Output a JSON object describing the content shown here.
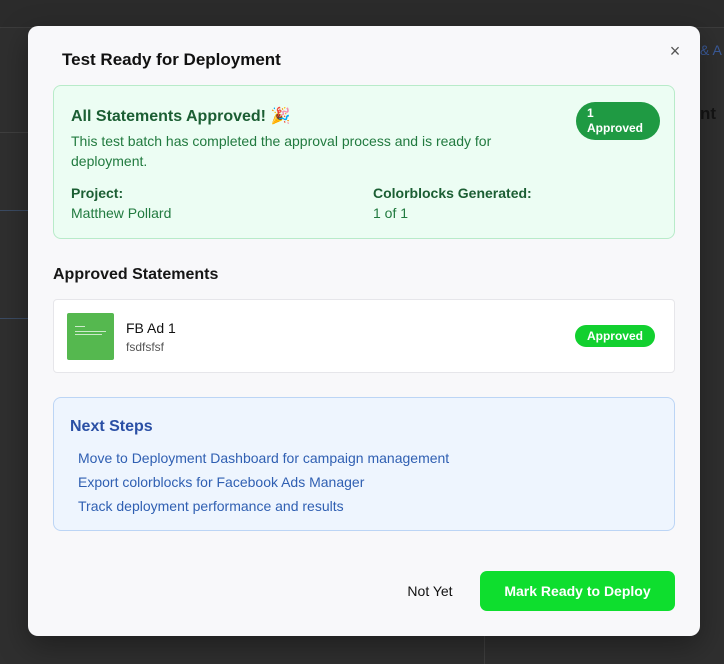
{
  "background": {
    "tabs_fragment": "& A",
    "title_fragment": "nt"
  },
  "modal": {
    "title": "Test Ready for Deployment",
    "close_icon": "×",
    "status_card": {
      "heading": "All Statements Approved! 🎉",
      "description": "This test batch has completed the approval process and is ready for deployment.",
      "badge_count": "1",
      "badge_label": "Approved",
      "project_label": "Project:",
      "project_value": "Matthew Pollard",
      "colorblocks_label": "Colorblocks Generated:",
      "colorblocks_value": "1 of 1"
    },
    "approved_section": {
      "title": "Approved Statements",
      "items": [
        {
          "name": "FB Ad 1",
          "subtitle": "fsdfsfsf",
          "status": "Approved",
          "thumb_color": "#55b84f"
        }
      ]
    },
    "next_steps": {
      "title": "Next Steps",
      "items": [
        "Move to Deployment Dashboard for campaign management",
        "Export colorblocks for Facebook Ads Manager",
        "Track deployment performance and results"
      ]
    },
    "actions": {
      "secondary_label": "Not Yet",
      "primary_label": "Mark Ready to Deploy"
    }
  },
  "colors": {
    "success_dark": "#1f9a43",
    "success_bright": "#12d02f",
    "primary_button": "#0ede2e",
    "info_text": "#2f5fb2"
  }
}
